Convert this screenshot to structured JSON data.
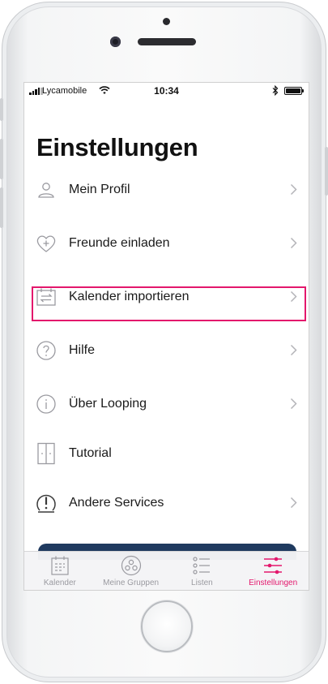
{
  "status_bar": {
    "carrier": "Lycamobile",
    "time": "10:34"
  },
  "page": {
    "title": "Einstellungen"
  },
  "menu": [
    {
      "label": "Mein Profil",
      "icon": "person-icon",
      "chevron": true
    },
    {
      "label": "Freunde einladen",
      "icon": "heart-plus-icon",
      "chevron": true
    },
    {
      "label": "Kalender importieren",
      "icon": "calendar-import-icon",
      "chevron": true,
      "highlighted": true
    },
    {
      "label": "Hilfe",
      "icon": "question-icon",
      "chevron": true
    },
    {
      "label": "Über Looping",
      "icon": "info-icon",
      "chevron": true
    },
    {
      "label": "Tutorial",
      "icon": "tutorial-icon",
      "chevron": false
    },
    {
      "label": "Andere Services",
      "icon": "alert-icon",
      "chevron": true
    }
  ],
  "tabbar": {
    "tabs": [
      {
        "label": "Kalender",
        "icon": "calendar-icon",
        "active": false
      },
      {
        "label": "Meine Gruppen",
        "icon": "groups-icon",
        "active": false
      },
      {
        "label": "Listen",
        "icon": "list-icon",
        "active": false
      },
      {
        "label": "Einstellungen",
        "icon": "sliders-icon",
        "active": true
      }
    ]
  },
  "colors": {
    "accent": "#e3176c",
    "icon_gray": "#9a9aa0",
    "cta_navy": "#1f3a5f",
    "text": "#1a1a1a"
  }
}
